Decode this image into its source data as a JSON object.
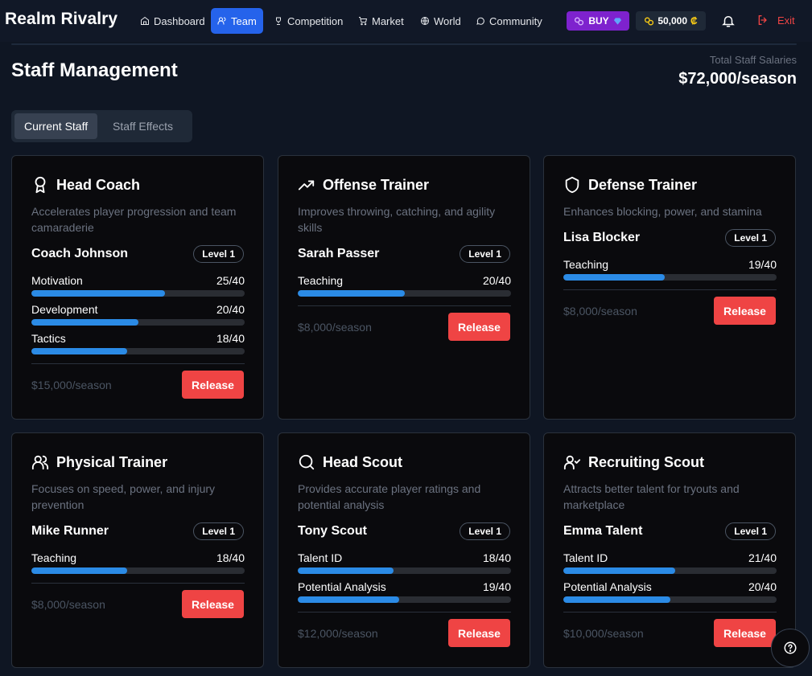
{
  "app": {
    "brand": "Realm Rivalry"
  },
  "nav": {
    "items": [
      {
        "label": "Dashboard",
        "icon": "home-icon"
      },
      {
        "label": "Team",
        "icon": "users-icon",
        "active": true
      },
      {
        "label": "Competition",
        "icon": "trophy-icon"
      },
      {
        "label": "Market",
        "icon": "cart-icon"
      },
      {
        "label": "World",
        "icon": "globe-icon"
      },
      {
        "label": "Community",
        "icon": "chat-icon"
      }
    ],
    "buy_label": "BUY",
    "coins": "50,000",
    "exit_label": "Exit"
  },
  "page": {
    "title": "Staff Management",
    "salaries_label": "Total Staff Salaries",
    "salaries_value": "$72,000/season"
  },
  "tabs": [
    "Current Staff",
    "Staff Effects"
  ],
  "staff": [
    {
      "role": "Head Coach",
      "icon": "award-icon",
      "desc": "Accelerates player progression and team camaraderie",
      "name": "Coach Johnson",
      "level": "Level 1",
      "stats": [
        {
          "label": "Motivation",
          "value": "25/40",
          "fraction": 0.625
        },
        {
          "label": "Development",
          "value": "20/40",
          "fraction": 0.5
        },
        {
          "label": "Tactics",
          "value": "18/40",
          "fraction": 0.45
        }
      ],
      "salary": "$15,000/season",
      "release": "Release"
    },
    {
      "role": "Offense Trainer",
      "icon": "trending-up-icon",
      "desc": "Improves throwing, catching, and agility skills",
      "name": "Sarah Passer",
      "level": "Level 1",
      "stats": [
        {
          "label": "Teaching",
          "value": "20/40",
          "fraction": 0.5
        }
      ],
      "salary": "$8,000/season",
      "release": "Release"
    },
    {
      "role": "Defense Trainer",
      "icon": "shield-icon",
      "desc": "Enhances blocking, power, and stamina",
      "name": "Lisa Blocker",
      "level": "Level 1",
      "stats": [
        {
          "label": "Teaching",
          "value": "19/40",
          "fraction": 0.475
        }
      ],
      "salary": "$8,000/season",
      "release": "Release"
    },
    {
      "role": "Physical Trainer",
      "icon": "users-icon",
      "desc": "Focuses on speed, power, and injury prevention",
      "name": "Mike Runner",
      "level": "Level 1",
      "stats": [
        {
          "label": "Teaching",
          "value": "18/40",
          "fraction": 0.45
        }
      ],
      "salary": "$8,000/season",
      "release": "Release"
    },
    {
      "role": "Head Scout",
      "icon": "search-icon",
      "desc": "Provides accurate player ratings and potential analysis",
      "name": "Tony Scout",
      "level": "Level 1",
      "stats": [
        {
          "label": "Talent ID",
          "value": "18/40",
          "fraction": 0.45
        },
        {
          "label": "Potential Analysis",
          "value": "19/40",
          "fraction": 0.475
        }
      ],
      "salary": "$12,000/season",
      "release": "Release"
    },
    {
      "role": "Recruiting Scout",
      "icon": "user-check-icon",
      "desc": "Attracts better talent for tryouts and marketplace",
      "name": "Emma Talent",
      "level": "Level 1",
      "stats": [
        {
          "label": "Talent ID",
          "value": "21/40",
          "fraction": 0.525
        },
        {
          "label": "Potential Analysis",
          "value": "20/40",
          "fraction": 0.5
        }
      ],
      "salary": "$10,000/season",
      "release": "Release"
    }
  ]
}
